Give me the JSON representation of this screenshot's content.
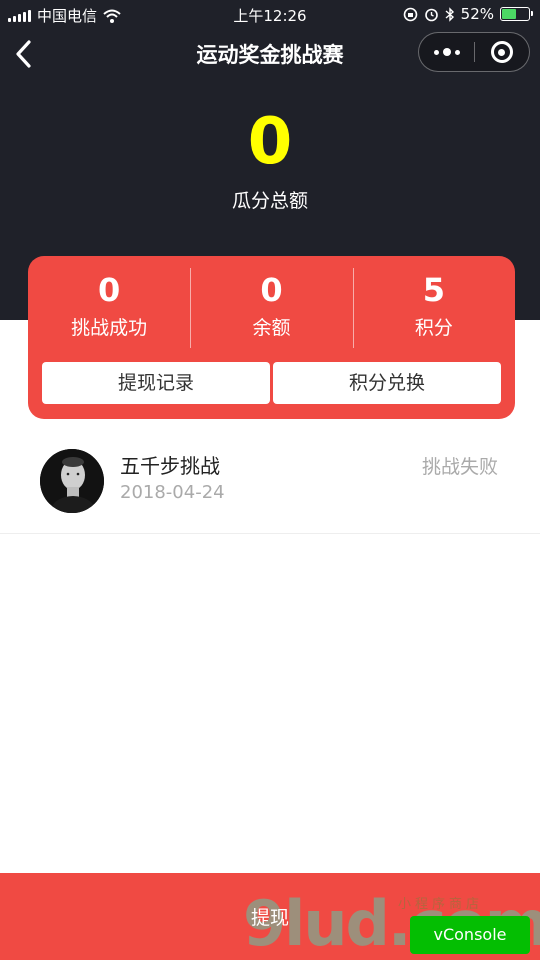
{
  "status_bar": {
    "carrier": "中国电信",
    "time": "上午12:26",
    "battery_percent": "52%",
    "battery_level": 0.52
  },
  "nav": {
    "title": "运动奖金挑战赛",
    "back_icon": "chevron-left-icon",
    "more_icon": "more-dots-icon",
    "close_icon": "target-close-icon"
  },
  "summary": {
    "total_amount": "0",
    "total_label": "瓜分总额",
    "amount_color": "#ffff00"
  },
  "stats": [
    {
      "value": "0",
      "label": "挑战成功"
    },
    {
      "value": "0",
      "label": "余额"
    },
    {
      "value": "5",
      "label": "积分"
    }
  ],
  "card_buttons": {
    "withdraw_record": "提现记录",
    "points_exchange": "积分兑换"
  },
  "records": [
    {
      "title": "五千步挑战",
      "date": "2018-04-24",
      "status": "挑战失败"
    }
  ],
  "bottom": {
    "withdraw_label": "提现",
    "vconsole_label": "vConsole",
    "watermark_text": "9lud.com",
    "watermark_tagline": "小程序商店"
  },
  "colors": {
    "header_bg": "#1f2129",
    "accent_red": "#f04a43",
    "vconsole_green": "#04be02"
  }
}
